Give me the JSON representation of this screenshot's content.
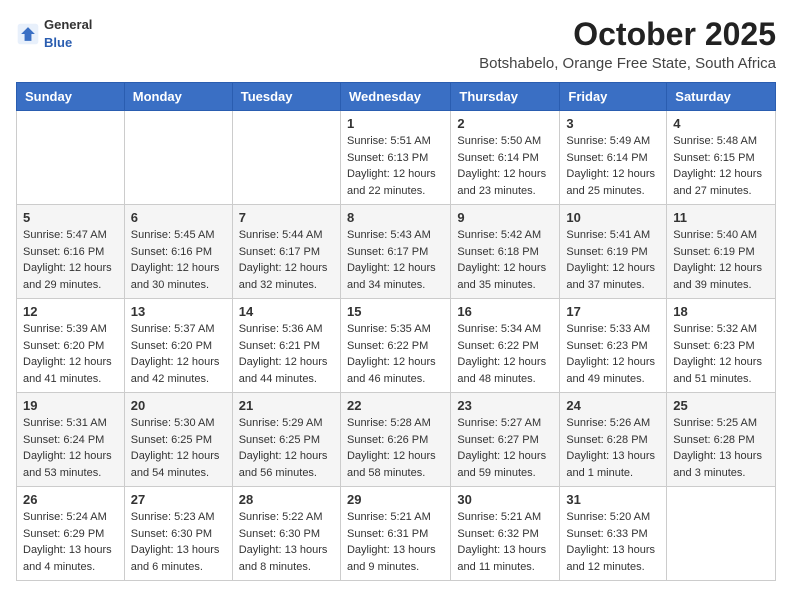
{
  "logo": {
    "general": "General",
    "blue": "Blue"
  },
  "title": "October 2025",
  "subtitle": "Botshabelo, Orange Free State, South Africa",
  "days_header": [
    "Sunday",
    "Monday",
    "Tuesday",
    "Wednesday",
    "Thursday",
    "Friday",
    "Saturday"
  ],
  "weeks": [
    [
      {
        "day": "",
        "sunrise": "",
        "sunset": "",
        "daylight": ""
      },
      {
        "day": "",
        "sunrise": "",
        "sunset": "",
        "daylight": ""
      },
      {
        "day": "",
        "sunrise": "",
        "sunset": "",
        "daylight": ""
      },
      {
        "day": "1",
        "sunrise": "Sunrise: 5:51 AM",
        "sunset": "Sunset: 6:13 PM",
        "daylight": "Daylight: 12 hours and 22 minutes."
      },
      {
        "day": "2",
        "sunrise": "Sunrise: 5:50 AM",
        "sunset": "Sunset: 6:14 PM",
        "daylight": "Daylight: 12 hours and 23 minutes."
      },
      {
        "day": "3",
        "sunrise": "Sunrise: 5:49 AM",
        "sunset": "Sunset: 6:14 PM",
        "daylight": "Daylight: 12 hours and 25 minutes."
      },
      {
        "day": "4",
        "sunrise": "Sunrise: 5:48 AM",
        "sunset": "Sunset: 6:15 PM",
        "daylight": "Daylight: 12 hours and 27 minutes."
      }
    ],
    [
      {
        "day": "5",
        "sunrise": "Sunrise: 5:47 AM",
        "sunset": "Sunset: 6:16 PM",
        "daylight": "Daylight: 12 hours and 29 minutes."
      },
      {
        "day": "6",
        "sunrise": "Sunrise: 5:45 AM",
        "sunset": "Sunset: 6:16 PM",
        "daylight": "Daylight: 12 hours and 30 minutes."
      },
      {
        "day": "7",
        "sunrise": "Sunrise: 5:44 AM",
        "sunset": "Sunset: 6:17 PM",
        "daylight": "Daylight: 12 hours and 32 minutes."
      },
      {
        "day": "8",
        "sunrise": "Sunrise: 5:43 AM",
        "sunset": "Sunset: 6:17 PM",
        "daylight": "Daylight: 12 hours and 34 minutes."
      },
      {
        "day": "9",
        "sunrise": "Sunrise: 5:42 AM",
        "sunset": "Sunset: 6:18 PM",
        "daylight": "Daylight: 12 hours and 35 minutes."
      },
      {
        "day": "10",
        "sunrise": "Sunrise: 5:41 AM",
        "sunset": "Sunset: 6:19 PM",
        "daylight": "Daylight: 12 hours and 37 minutes."
      },
      {
        "day": "11",
        "sunrise": "Sunrise: 5:40 AM",
        "sunset": "Sunset: 6:19 PM",
        "daylight": "Daylight: 12 hours and 39 minutes."
      }
    ],
    [
      {
        "day": "12",
        "sunrise": "Sunrise: 5:39 AM",
        "sunset": "Sunset: 6:20 PM",
        "daylight": "Daylight: 12 hours and 41 minutes."
      },
      {
        "day": "13",
        "sunrise": "Sunrise: 5:37 AM",
        "sunset": "Sunset: 6:20 PM",
        "daylight": "Daylight: 12 hours and 42 minutes."
      },
      {
        "day": "14",
        "sunrise": "Sunrise: 5:36 AM",
        "sunset": "Sunset: 6:21 PM",
        "daylight": "Daylight: 12 hours and 44 minutes."
      },
      {
        "day": "15",
        "sunrise": "Sunrise: 5:35 AM",
        "sunset": "Sunset: 6:22 PM",
        "daylight": "Daylight: 12 hours and 46 minutes."
      },
      {
        "day": "16",
        "sunrise": "Sunrise: 5:34 AM",
        "sunset": "Sunset: 6:22 PM",
        "daylight": "Daylight: 12 hours and 48 minutes."
      },
      {
        "day": "17",
        "sunrise": "Sunrise: 5:33 AM",
        "sunset": "Sunset: 6:23 PM",
        "daylight": "Daylight: 12 hours and 49 minutes."
      },
      {
        "day": "18",
        "sunrise": "Sunrise: 5:32 AM",
        "sunset": "Sunset: 6:23 PM",
        "daylight": "Daylight: 12 hours and 51 minutes."
      }
    ],
    [
      {
        "day": "19",
        "sunrise": "Sunrise: 5:31 AM",
        "sunset": "Sunset: 6:24 PM",
        "daylight": "Daylight: 12 hours and 53 minutes."
      },
      {
        "day": "20",
        "sunrise": "Sunrise: 5:30 AM",
        "sunset": "Sunset: 6:25 PM",
        "daylight": "Daylight: 12 hours and 54 minutes."
      },
      {
        "day": "21",
        "sunrise": "Sunrise: 5:29 AM",
        "sunset": "Sunset: 6:25 PM",
        "daylight": "Daylight: 12 hours and 56 minutes."
      },
      {
        "day": "22",
        "sunrise": "Sunrise: 5:28 AM",
        "sunset": "Sunset: 6:26 PM",
        "daylight": "Daylight: 12 hours and 58 minutes."
      },
      {
        "day": "23",
        "sunrise": "Sunrise: 5:27 AM",
        "sunset": "Sunset: 6:27 PM",
        "daylight": "Daylight: 12 hours and 59 minutes."
      },
      {
        "day": "24",
        "sunrise": "Sunrise: 5:26 AM",
        "sunset": "Sunset: 6:28 PM",
        "daylight": "Daylight: 13 hours and 1 minute."
      },
      {
        "day": "25",
        "sunrise": "Sunrise: 5:25 AM",
        "sunset": "Sunset: 6:28 PM",
        "daylight": "Daylight: 13 hours and 3 minutes."
      }
    ],
    [
      {
        "day": "26",
        "sunrise": "Sunrise: 5:24 AM",
        "sunset": "Sunset: 6:29 PM",
        "daylight": "Daylight: 13 hours and 4 minutes."
      },
      {
        "day": "27",
        "sunrise": "Sunrise: 5:23 AM",
        "sunset": "Sunset: 6:30 PM",
        "daylight": "Daylight: 13 hours and 6 minutes."
      },
      {
        "day": "28",
        "sunrise": "Sunrise: 5:22 AM",
        "sunset": "Sunset: 6:30 PM",
        "daylight": "Daylight: 13 hours and 8 minutes."
      },
      {
        "day": "29",
        "sunrise": "Sunrise: 5:21 AM",
        "sunset": "Sunset: 6:31 PM",
        "daylight": "Daylight: 13 hours and 9 minutes."
      },
      {
        "day": "30",
        "sunrise": "Sunrise: 5:21 AM",
        "sunset": "Sunset: 6:32 PM",
        "daylight": "Daylight: 13 hours and 11 minutes."
      },
      {
        "day": "31",
        "sunrise": "Sunrise: 5:20 AM",
        "sunset": "Sunset: 6:33 PM",
        "daylight": "Daylight: 13 hours and 12 minutes."
      },
      {
        "day": "",
        "sunrise": "",
        "sunset": "",
        "daylight": ""
      }
    ]
  ]
}
